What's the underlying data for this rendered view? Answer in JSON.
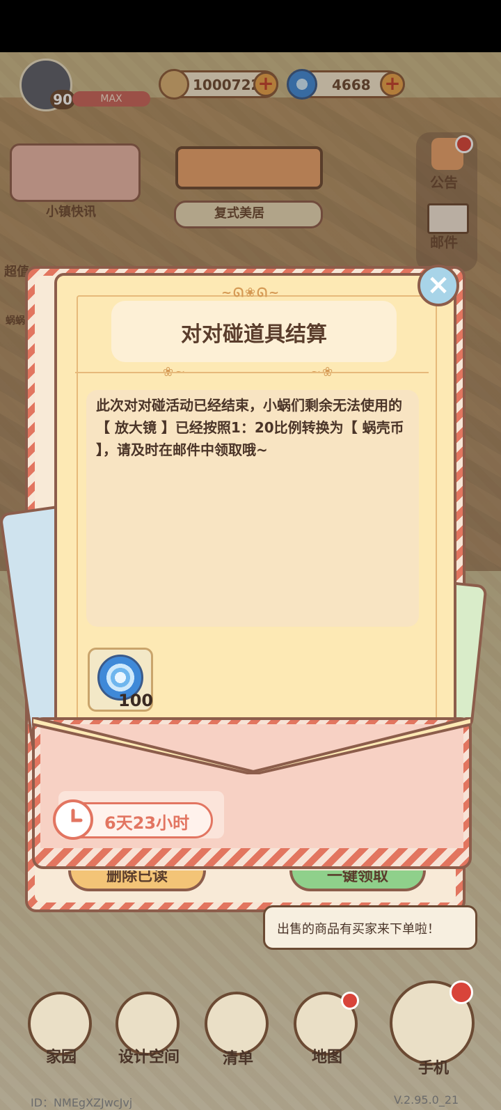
{
  "hud": {
    "level": "90",
    "level_max": "MAX",
    "gold": "1000722",
    "shells": "4668",
    "town_news": "小镇快讯",
    "super_label": "超值",
    "snail_label": "蜗蜗",
    "house_name": "复式美居",
    "announcement": "公告",
    "mail": "邮件"
  },
  "dialog": {
    "title": "对对碰道具结算",
    "message": "此次对对碰活动已经结束，小蜗们剩余无法使用的【 放大镜 】已经按照1：20比例转换为【 蜗壳币 】，请及时在邮件中领取哦~",
    "reward": {
      "icon": "snail-shell-coin-icon",
      "quantity": "100"
    },
    "timer": "6天23小时",
    "delete_read": "删除已读",
    "claim_all": "一键领取",
    "close_icon": "close-icon"
  },
  "bubble": {
    "text": "出售的商品有买家来下单啦！"
  },
  "nav": [
    {
      "label": "家园",
      "icon": "home-icon"
    },
    {
      "label": "设计空间",
      "icon": "design-ruler-icon"
    },
    {
      "label": "清单",
      "icon": "checklist-icon"
    },
    {
      "label": "地图",
      "icon": "map-pin-icon"
    },
    {
      "label": "手机",
      "icon": "phone-icon"
    }
  ],
  "footer": {
    "id": "ID：NMEgXZJwcJvj",
    "version": "V.2.95.0_21"
  },
  "colors": {
    "paper": "#fde9b4",
    "stripe": "#e2755f",
    "border": "#8c5d4b",
    "accent_text": "#5a3d2c"
  }
}
